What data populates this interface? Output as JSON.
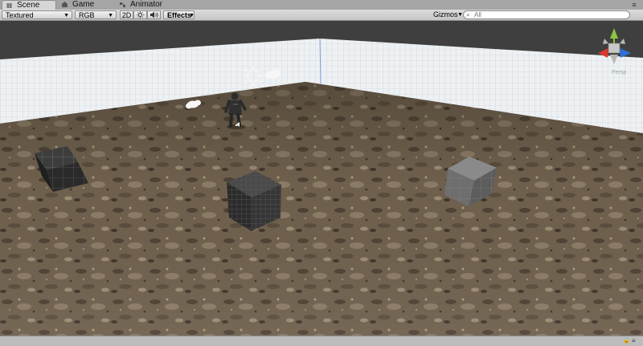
{
  "tabs": [
    {
      "label": "Scene",
      "icon": "scene-icon",
      "active": true
    },
    {
      "label": "Game",
      "icon": "game-icon",
      "active": false
    },
    {
      "label": "Animator",
      "icon": "animator-icon",
      "active": false
    }
  ],
  "toolbar": {
    "render_mode": "Textured",
    "color_mode": "RGB",
    "mode_2d": "2D",
    "lighting_icon": "sun-icon",
    "audio_icon": "speaker-icon",
    "effects": "Effects",
    "gizmos": "Gizmos",
    "search_placeholder": "All"
  },
  "viewport": {
    "persp_label": "Persp",
    "gizmo_axes": [
      "x",
      "y",
      "z"
    ],
    "gizmo_colors": {
      "x": "#d93a2b",
      "y": "#8cc63f",
      "z": "#2e6fd6"
    }
  },
  "colors": {
    "sky": "#3f3f3f",
    "plane": "#e7ecef",
    "ground": "#6e5f4c"
  }
}
